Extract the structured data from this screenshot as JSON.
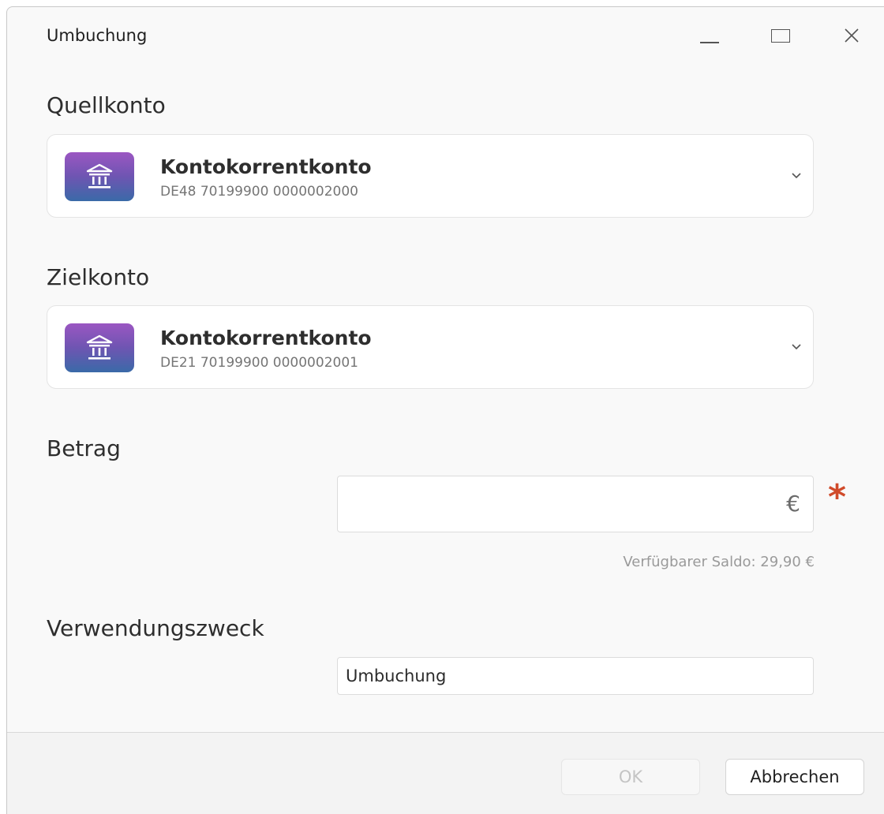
{
  "window": {
    "title": "Umbuchung"
  },
  "source_account": {
    "section_label": "Quellkonto",
    "name": "Kontokorrentkonto",
    "iban": "DE48 70199900 0000002000"
  },
  "target_account": {
    "section_label": "Zielkonto",
    "name": "Kontokorrentkonto",
    "iban": "DE21 70199900 0000002001"
  },
  "amount": {
    "section_label": "Betrag",
    "value": "",
    "currency_symbol": "€",
    "required_marker": "*",
    "available_balance": "Verfügbarer Saldo: 29,90 €"
  },
  "purpose": {
    "section_label": "Verwendungszweck",
    "value": "Umbuchung"
  },
  "footer": {
    "ok_label": "OK",
    "cancel_label": "Abbrechen"
  },
  "colors": {
    "tile_gradient_top": "#9b56c2",
    "tile_gradient_bottom": "#3a6aa8",
    "required_red": "#d04a2a"
  },
  "icons": {
    "account": "bank-icon",
    "dropdown": "chevron-down-icon",
    "minimize": "minimize-icon",
    "maximize": "maximize-icon",
    "close": "close-icon"
  }
}
